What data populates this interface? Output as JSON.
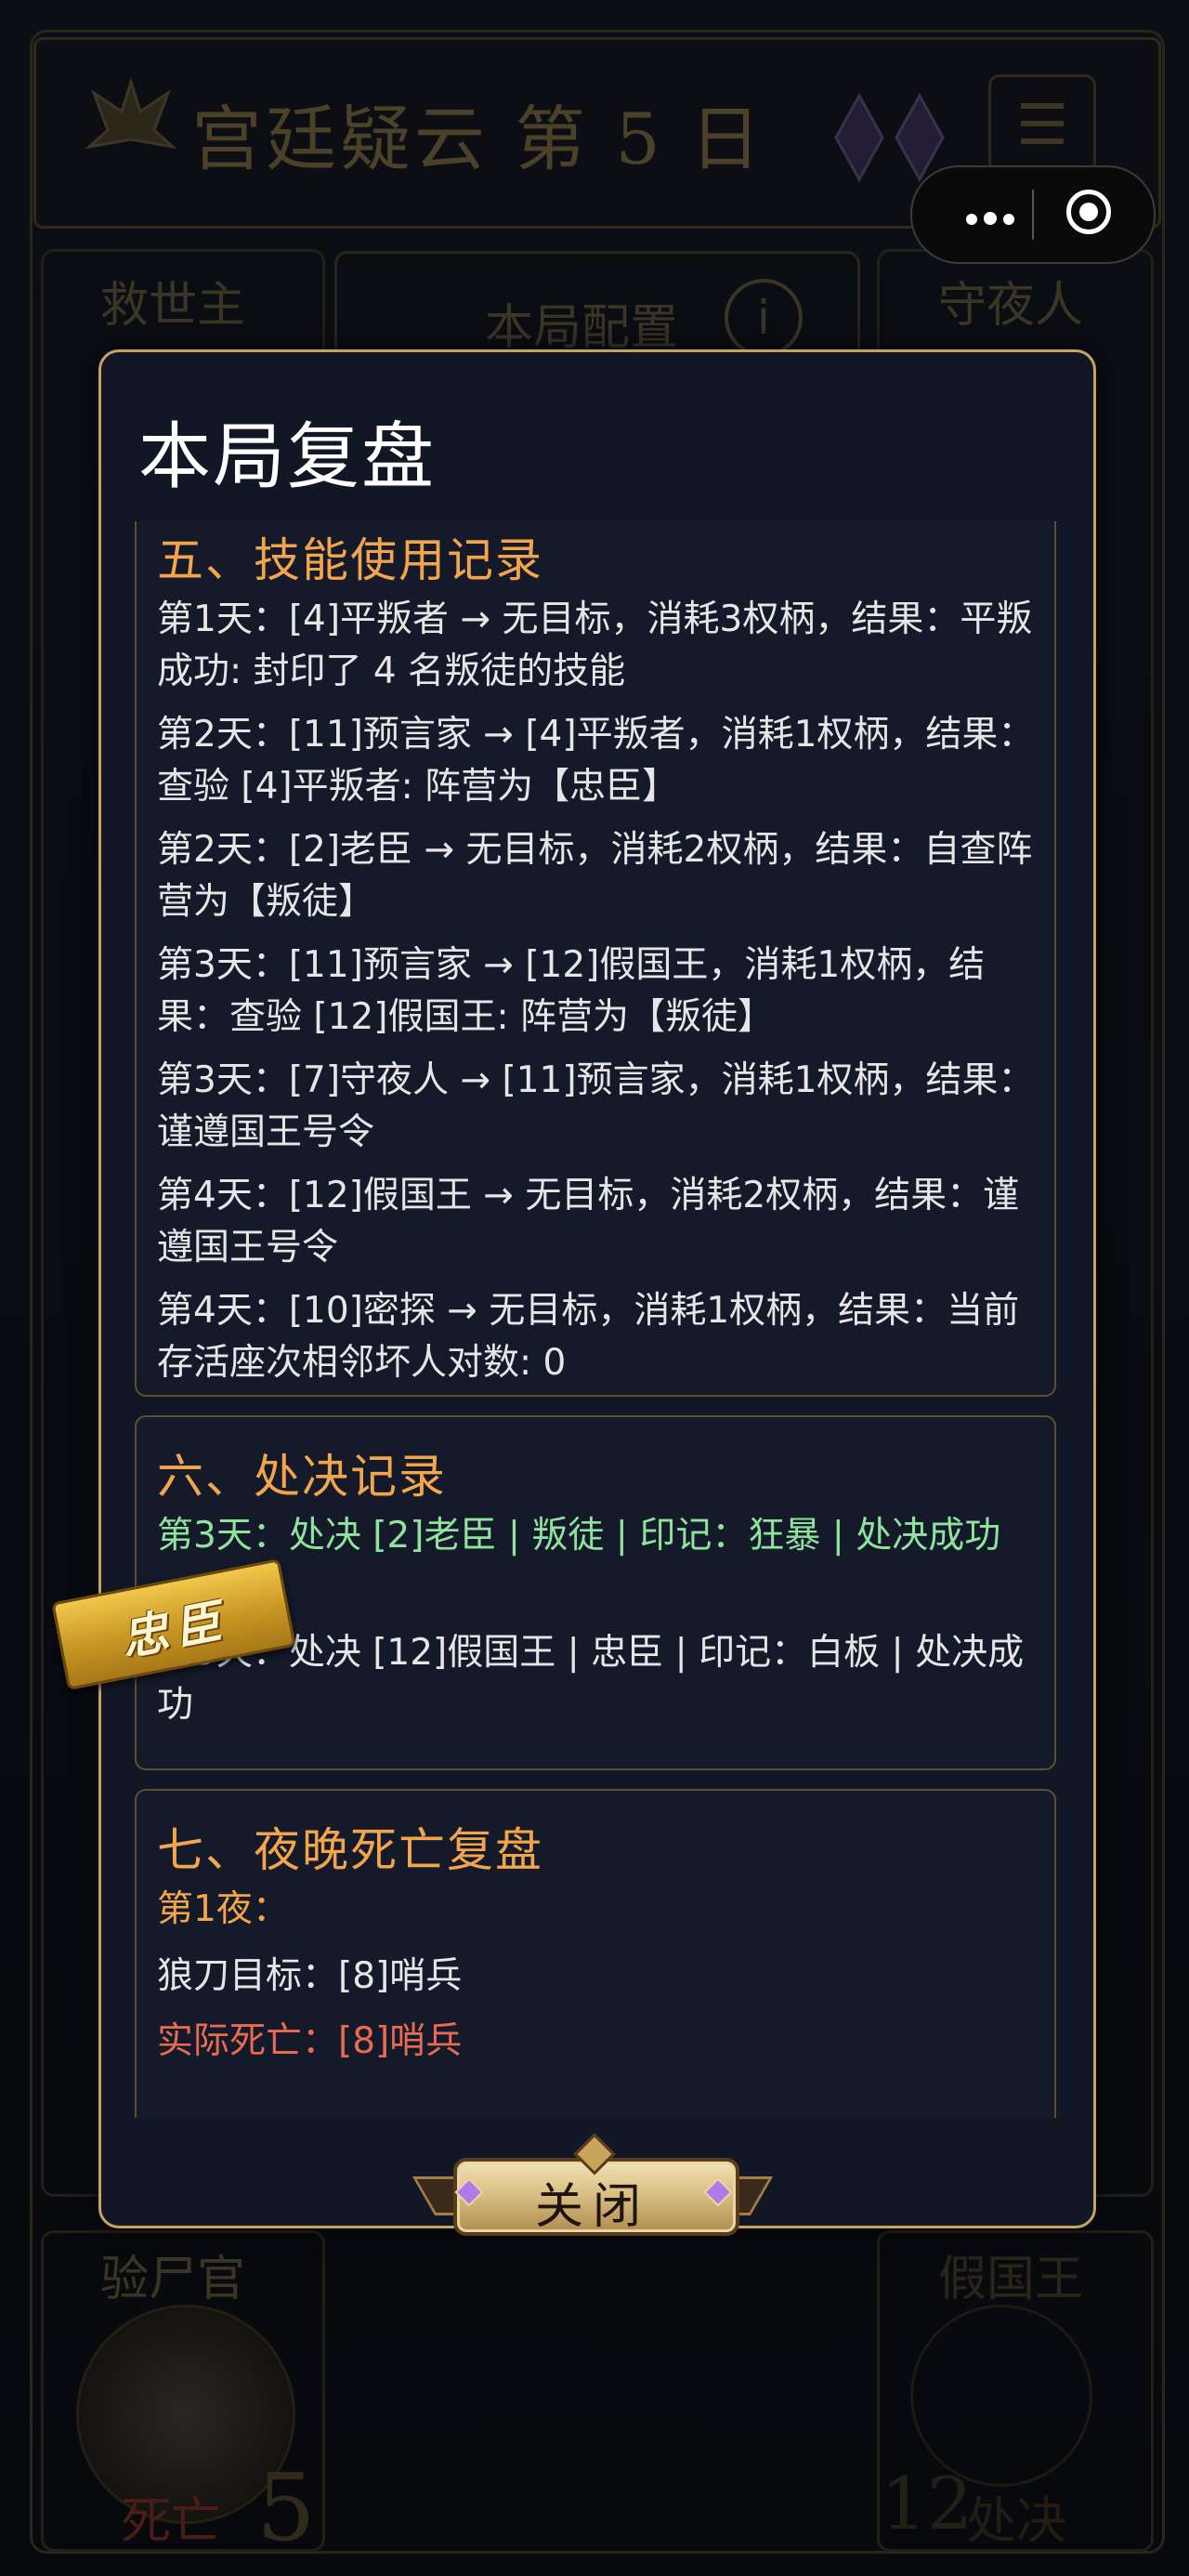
{
  "background": {
    "title": "宫廷疑云 第 5 日",
    "seats": {
      "top_left": "救世主",
      "top_right": "守夜人",
      "bottom_left": "验尸官",
      "bottom_right": "假国王"
    },
    "config_label": "本局配置",
    "info_icon": "i",
    "bottom_left_status": "死亡",
    "bottom_left_number": "5",
    "bottom_right_number": "12",
    "bottom_right_status": "处决"
  },
  "modal": {
    "title": "本局复盘",
    "sections": [
      {
        "heading": "五、技能使用记录",
        "entries": [
          "第1天：[4]平叛者 → 无目标，消耗3权柄，结果：平叛成功: 封印了 4 名叛徒的技能",
          "第2天：[11]预言家 → [4]平叛者，消耗1权柄，结果：查验 [4]平叛者: 阵营为【忠臣】",
          "第2天：[2]老臣 → 无目标，消耗2权柄，结果：自查阵营为【叛徒】",
          "第3天：[11]预言家 → [12]假国王，消耗1权柄，结果：查验 [12]假国王: 阵营为【叛徒】",
          "第3天：[7]守夜人 → [11]预言家，消耗1权柄，结果：谨遵国王号令",
          "第4天：[12]假国王 → 无目标，消耗2权柄，结果：谨遵国王号令",
          "第4天：[10]密探 → 无目标，消耗1权柄，结果：当前存活座次相邻坏人对数: 0"
        ]
      },
      {
        "heading": "六、处决记录",
        "entries": [
          "第3天：处决 [2]老臣 | 叛徒 | 印记：狂暴 | 处决成功",
          "第5天：处决 [12]假国王 | 忠臣 | 印记：白板 | 处决成功"
        ]
      },
      {
        "heading": "七、夜晚死亡复盘",
        "entries": [
          "第1夜：",
          "狼刀目标：[8]哨兵",
          "实际死亡：[8]哨兵"
        ]
      }
    ],
    "stamp": "忠臣",
    "close_label": "关闭"
  },
  "colors": {
    "accent_gold": "#f2a54a",
    "border_gold": "#c8a262",
    "highlight_green": "#8fe39d",
    "death_red": "#e86a50"
  }
}
